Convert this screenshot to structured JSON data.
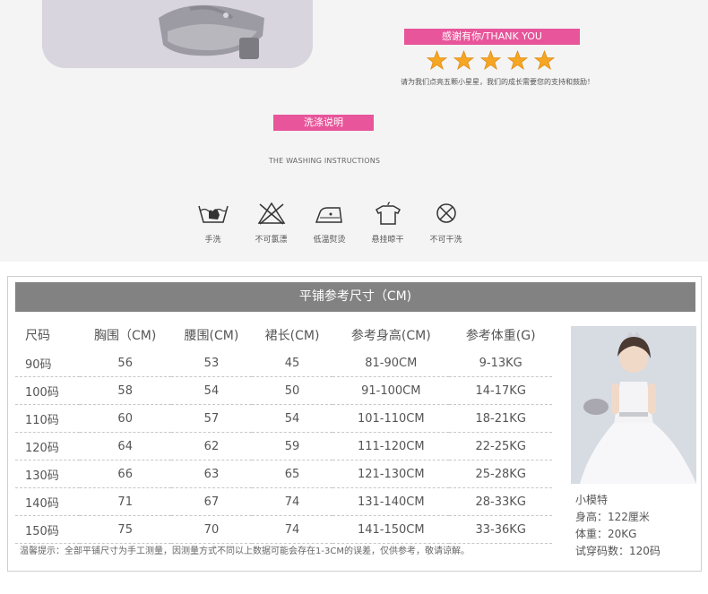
{
  "thanks": {
    "banner": "感谢有你/THANK YOU",
    "star_count": 5,
    "text": "请为我们点亮五颗小星星，我们的成长需要您的支持和鼓励！"
  },
  "washing": {
    "banner": "洗涤说明",
    "subtitle": "THE WASHING INSTRUCTIONS",
    "items": [
      {
        "icon": "hand-wash-icon",
        "label": "手洗"
      },
      {
        "icon": "no-bleach-icon",
        "label": "不可氯漂"
      },
      {
        "icon": "low-iron-icon",
        "label": "低温熨烫"
      },
      {
        "icon": "hang-dry-icon",
        "label": "悬挂晾干"
      },
      {
        "icon": "no-tumble-dry-icon",
        "label": "不可干洗"
      }
    ]
  },
  "size_table": {
    "title": "平铺参考尺寸（CM)",
    "headers": [
      "尺码",
      "胸围（CM)",
      "腰围(CM)",
      "裙长(CM)",
      "参考身高(CM)",
      "参考体重(G)"
    ],
    "rows": [
      [
        "90码",
        "56",
        "53",
        "45",
        "81-90CM",
        "9-13KG"
      ],
      [
        "100码",
        "58",
        "54",
        "50",
        "91-100CM",
        "14-17KG"
      ],
      [
        "110码",
        "60",
        "57",
        "54",
        "101-110CM",
        "18-21KG"
      ],
      [
        "120码",
        "64",
        "62",
        "59",
        "111-120CM",
        "22-25KG"
      ],
      [
        "130码",
        "66",
        "63",
        "65",
        "121-130CM",
        "25-28KG"
      ],
      [
        "140码",
        "71",
        "67",
        "74",
        "131-140CM",
        "28-33KG"
      ],
      [
        "150码",
        "75",
        "70",
        "74",
        "141-150CM",
        "33-36KG"
      ]
    ],
    "footnote": "温馨提示：全部平铺尺寸为手工测量，因测量方式不同以上数据可能会存在1-3CM的误差，仅供参考，敬请谅解。"
  },
  "model": {
    "label": "小模特",
    "height": "身高：122厘米",
    "weight": "体重：20KG",
    "size": "试穿码数：120码"
  },
  "colors": {
    "accent": "#e8559a",
    "table_header_bg": "#828282",
    "star": "#f5a623"
  }
}
